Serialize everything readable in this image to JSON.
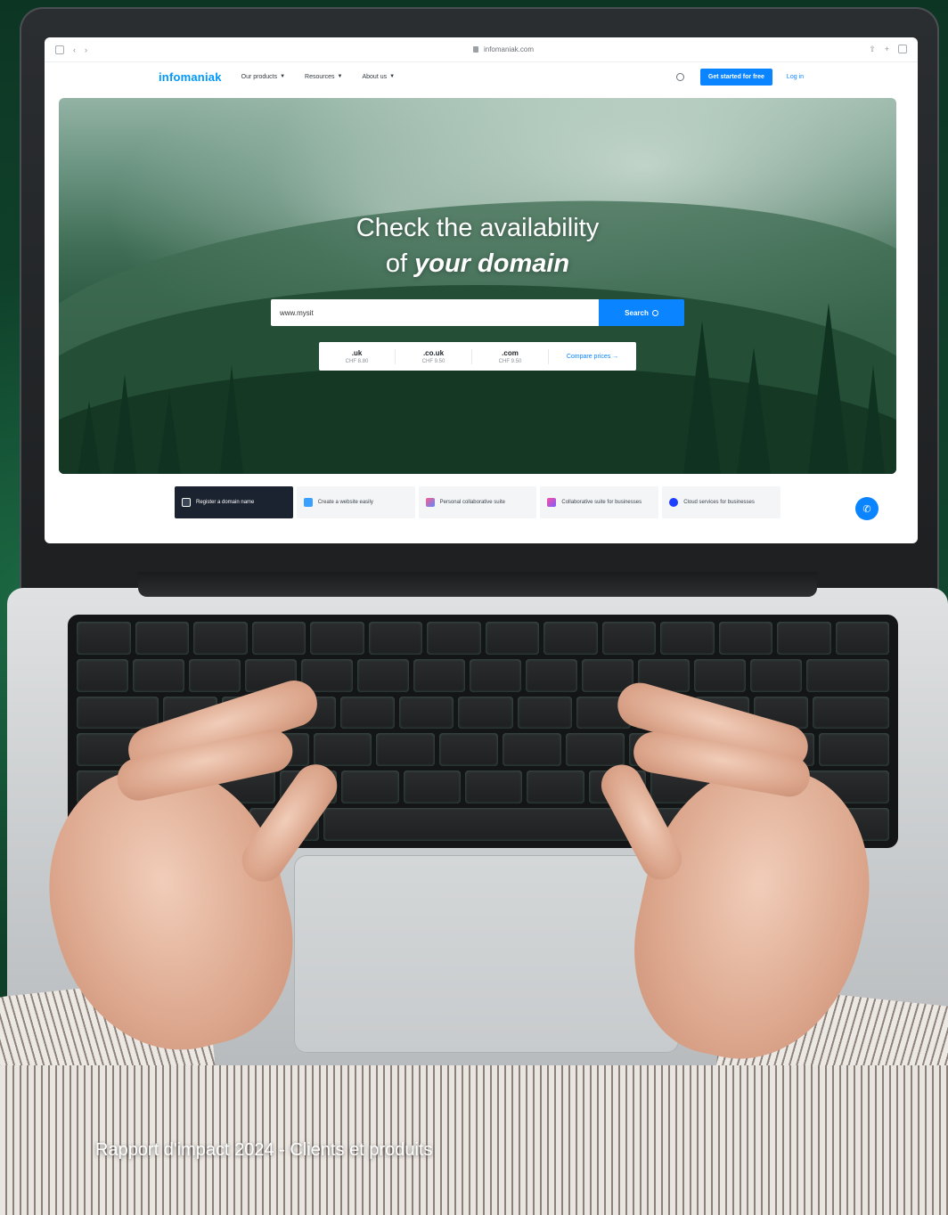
{
  "browser": {
    "url": "infomaniak.com"
  },
  "site": {
    "logo": "infomaniak",
    "nav": [
      {
        "label": "Our products"
      },
      {
        "label": "Resources"
      },
      {
        "label": "About us"
      }
    ],
    "cta_label": "Get started for free",
    "login_label": "Log in"
  },
  "hero": {
    "title_line1": "Check the availability",
    "title_line2_prefix": "of",
    "title_line2_emphasis": "your domain",
    "input_value": "www.mysit",
    "search_label": "Search",
    "tlds": [
      {
        "name": ".uk",
        "price": "CHF 8.80"
      },
      {
        "name": ".co.uk",
        "price": "CHF 9.50"
      },
      {
        "name": ".com",
        "price": "CHF 9.50"
      }
    ],
    "compare_label": "Compare prices →"
  },
  "products": [
    {
      "label": "Register a domain name",
      "icon": "domain-icon",
      "color": "#ffffff"
    },
    {
      "label": "Create a website easily",
      "icon": "website-icon",
      "color": "#3aa0ff"
    },
    {
      "label": "Personal collaborative suite",
      "icon": "suite-icon",
      "color": "#b05cff"
    },
    {
      "label": "Collaborative suite for businesses",
      "icon": "business-suite-icon",
      "color": "#7a5cff"
    },
    {
      "label": "Cloud services for businesses",
      "icon": "cloud-icon",
      "color": "#1d3fff"
    }
  ],
  "colors": {
    "brand": "#0098ff",
    "cta": "#0a84ff",
    "active_tab": "#1b2330"
  },
  "caption": "Rapport d'impact 2024 - Clients et produits"
}
